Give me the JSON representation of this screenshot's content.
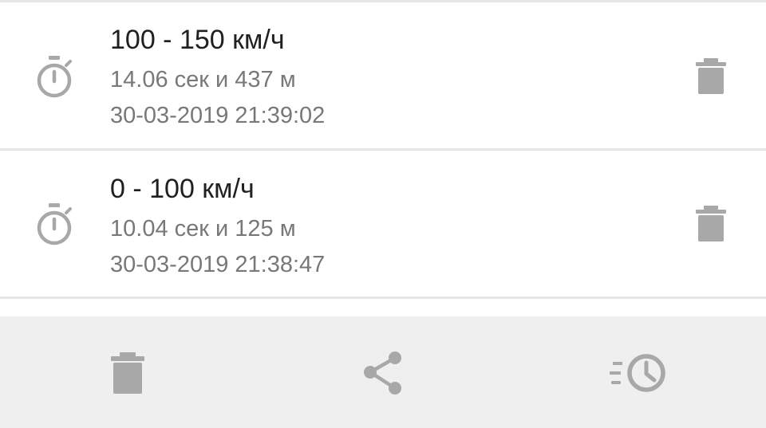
{
  "results": [
    {
      "speed_range": "100 - 150 км/ч",
      "time_distance": "14.06 сек и 437 м",
      "timestamp": "30-03-2019 21:39:02"
    },
    {
      "speed_range": "0 - 100 км/ч",
      "time_distance": "10.04 сек и 125 м",
      "timestamp": "30-03-2019 21:38:47"
    }
  ],
  "icons": {
    "item_leading": "stopwatch-icon",
    "item_trailing": "trash-icon",
    "bottom_bar": [
      "trash-icon",
      "share-icon",
      "history-icon"
    ]
  },
  "colors": {
    "background": "#ffffff",
    "divider": "#e6e6e6",
    "primary_text": "#202020",
    "secondary_text": "#787878",
    "icon": "#a8a8a8",
    "bottom_bar": "#efefef"
  }
}
